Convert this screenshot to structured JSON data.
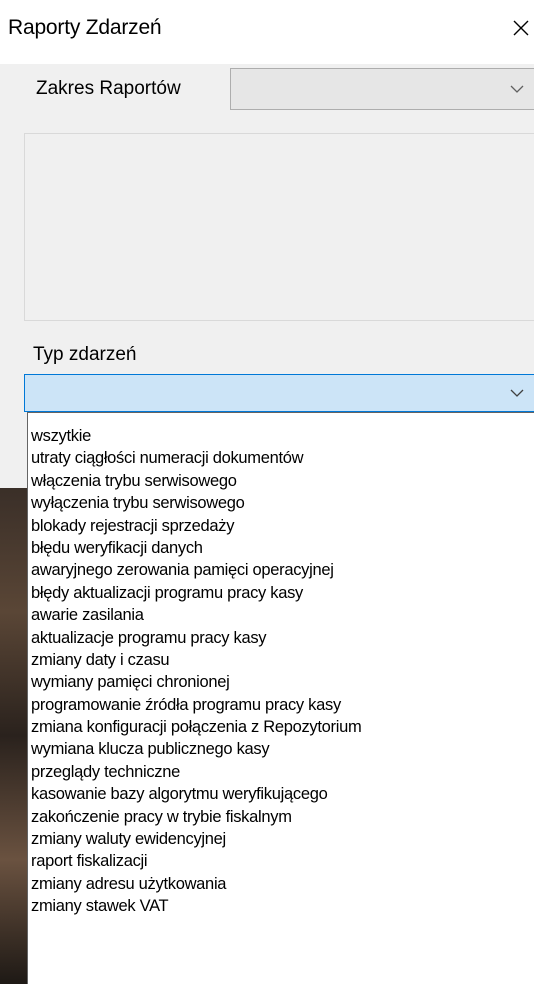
{
  "window": {
    "title": "Raporty Zdarzeń"
  },
  "range": {
    "label": "Zakres Raportów",
    "value": ""
  },
  "event_type": {
    "label": "Typ zdarzeń",
    "value": ""
  },
  "dropdown": {
    "items": [
      "wszytkie",
      "utraty ciągłości numeracji dokumentów",
      "włączenia trybu serwisowego",
      "wyłączenia trybu serwisowego",
      "blokady rejestracji sprzedaży",
      "błędu weryfikacji danych",
      "awaryjnego zerowania pamięci operacyjnej",
      "błędy aktualizacji programu pracy kasy",
      "awarie zasilania",
      "aktualizacje programu pracy kasy",
      "zmiany daty i czasu",
      "wymiany pamięci chronionej",
      "programowanie źródła programu pracy kasy",
      "zmiana konfiguracji połączenia z Repozytorium",
      "wymiana klucza publicznego kasy",
      "przeglądy techniczne",
      "kasowanie bazy algorytmu weryfikującego",
      "zakończenie pracy w trybie fiskalnym",
      "zmiany waluty ewidencyjnej",
      "raport fiskalizacji",
      "zmiany adresu użytkowania",
      "zmiany stawek VAT"
    ]
  },
  "icons": {
    "close": "close-icon",
    "chevron": "chevron-down-icon"
  }
}
